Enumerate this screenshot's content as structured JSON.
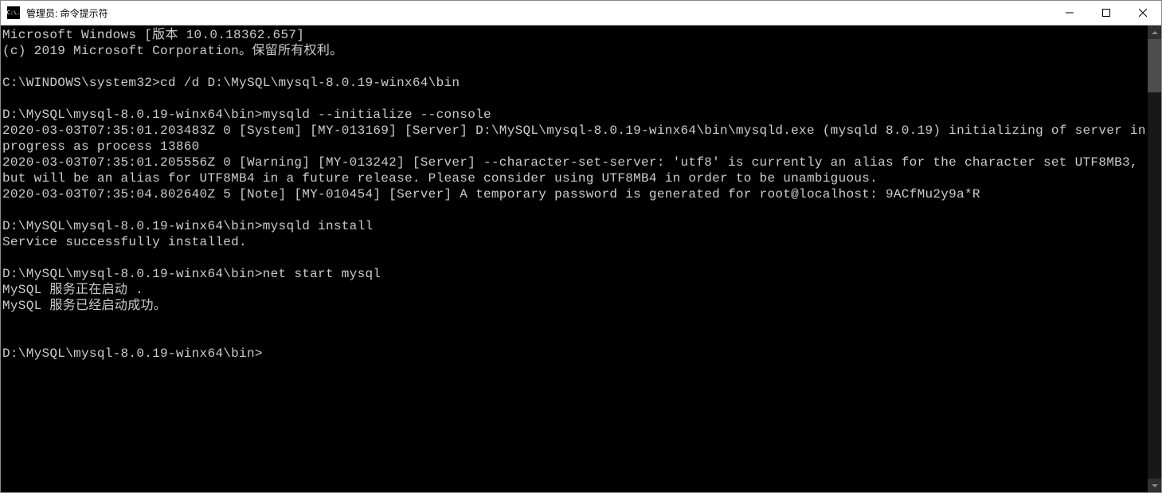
{
  "titlebar": {
    "icon_text": "C:\\.",
    "title": "管理员: 命令提示符"
  },
  "console": {
    "lines": [
      "Microsoft Windows [版本 10.0.18362.657]",
      "(c) 2019 Microsoft Corporation。保留所有权利。",
      "",
      "C:\\WINDOWS\\system32>cd /d D:\\MySQL\\mysql-8.0.19-winx64\\bin",
      "",
      "D:\\MySQL\\mysql-8.0.19-winx64\\bin>mysqld --initialize --console",
      "2020-03-03T07:35:01.203483Z 0 [System] [MY-013169] [Server] D:\\MySQL\\mysql-8.0.19-winx64\\bin\\mysqld.exe (mysqld 8.0.19) initializing of server in progress as process 13860",
      "2020-03-03T07:35:01.205556Z 0 [Warning] [MY-013242] [Server] --character-set-server: 'utf8' is currently an alias for the character set UTF8MB3, but will be an alias for UTF8MB4 in a future release. Please consider using UTF8MB4 in order to be unambiguous.",
      "2020-03-03T07:35:04.802640Z 5 [Note] [MY-010454] [Server] A temporary password is generated for root@localhost: 9ACfMu2y9a*R",
      "",
      "D:\\MySQL\\mysql-8.0.19-winx64\\bin>mysqld install",
      "Service successfully installed.",
      "",
      "D:\\MySQL\\mysql-8.0.19-winx64\\bin>net start mysql",
      "MySQL 服务正在启动 .",
      "MySQL 服务已经启动成功。",
      "",
      "",
      "D:\\MySQL\\mysql-8.0.19-winx64\\bin>"
    ]
  }
}
